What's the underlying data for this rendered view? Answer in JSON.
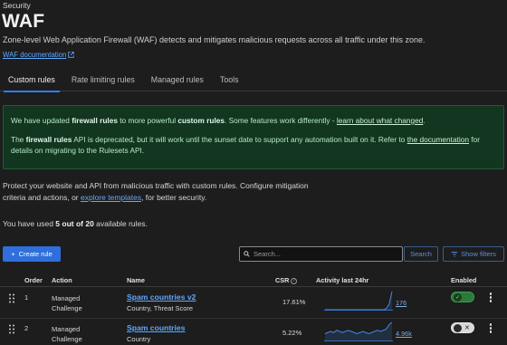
{
  "header": {
    "breadcrumb": "Security",
    "title": "WAF",
    "description": "Zone-level Web Application Firewall (WAF) detects and mitigates malicious requests across all traffic under this zone.",
    "doc_link": "WAF documentation"
  },
  "tabs": [
    {
      "label": "Custom rules",
      "active": true
    },
    {
      "label": "Rate limiting rules",
      "active": false
    },
    {
      "label": "Managed rules",
      "active": false
    },
    {
      "label": "Tools",
      "active": false
    }
  ],
  "notice": {
    "p1_a": "We have updated ",
    "p1_b": "firewall rules",
    "p1_c": " to more powerful ",
    "p1_d": "custom rules",
    "p1_e": ". Some features work differently - ",
    "p1_link": "learn about what changed",
    "p1_f": ".",
    "p2_a": "The ",
    "p2_b": "firewall rules",
    "p2_c": " API is deprecated, but it will work until the sunset date to support any automation built on it. Refer to ",
    "p2_link": "the documentation",
    "p2_d": " for details on migrating to the Rulesets API."
  },
  "intro": {
    "text_a": "Protect your website and API from malicious traffic with custom rules. Configure mitigation criteria and actions, or ",
    "link": "explore templates",
    "text_b": ", for better security."
  },
  "usage": {
    "prefix": "You have used ",
    "count": "5 out of 20",
    "suffix": " available rules."
  },
  "toolbar": {
    "create_label": "Create rule",
    "search_placeholder": "Search...",
    "search_button": "Search",
    "filter_button": "Show filters"
  },
  "table": {
    "headers": {
      "order": "Order",
      "action": "Action",
      "name": "Name",
      "csr": "CSR",
      "activity": "Activity last 24hr",
      "enabled": "Enabled"
    },
    "rows": [
      {
        "order": "1",
        "action_line1": "Managed",
        "action_line2": "Challenge",
        "name": "Spam countries v2",
        "fields": "Country, Threat Score",
        "csr": "17.61%",
        "activity": "176",
        "enabled": true,
        "sparkline": [
          0,
          0,
          0,
          0,
          0,
          0,
          0,
          0,
          0,
          0,
          0,
          0,
          0,
          0,
          0,
          0,
          0,
          0,
          0,
          0,
          0,
          1,
          5,
          17
        ]
      },
      {
        "order": "2",
        "action_line1": "Managed",
        "action_line2": "Challenge",
        "name": "Spam countries",
        "fields": "Country",
        "csr": "5.22%",
        "activity": "4.96k",
        "enabled": false,
        "sparkline": [
          6,
          7,
          8,
          7,
          9,
          8,
          7,
          8,
          9,
          8,
          7,
          6,
          7,
          8,
          7,
          6,
          7,
          8,
          9,
          8,
          9,
          10,
          14,
          16
        ]
      }
    ]
  },
  "colors": {
    "accent": "#2f7df6",
    "link": "#5fa8ff",
    "notice_bg": "#123620",
    "sparkline": "#3f86e6",
    "toggle_on": "#2c7a3b"
  }
}
